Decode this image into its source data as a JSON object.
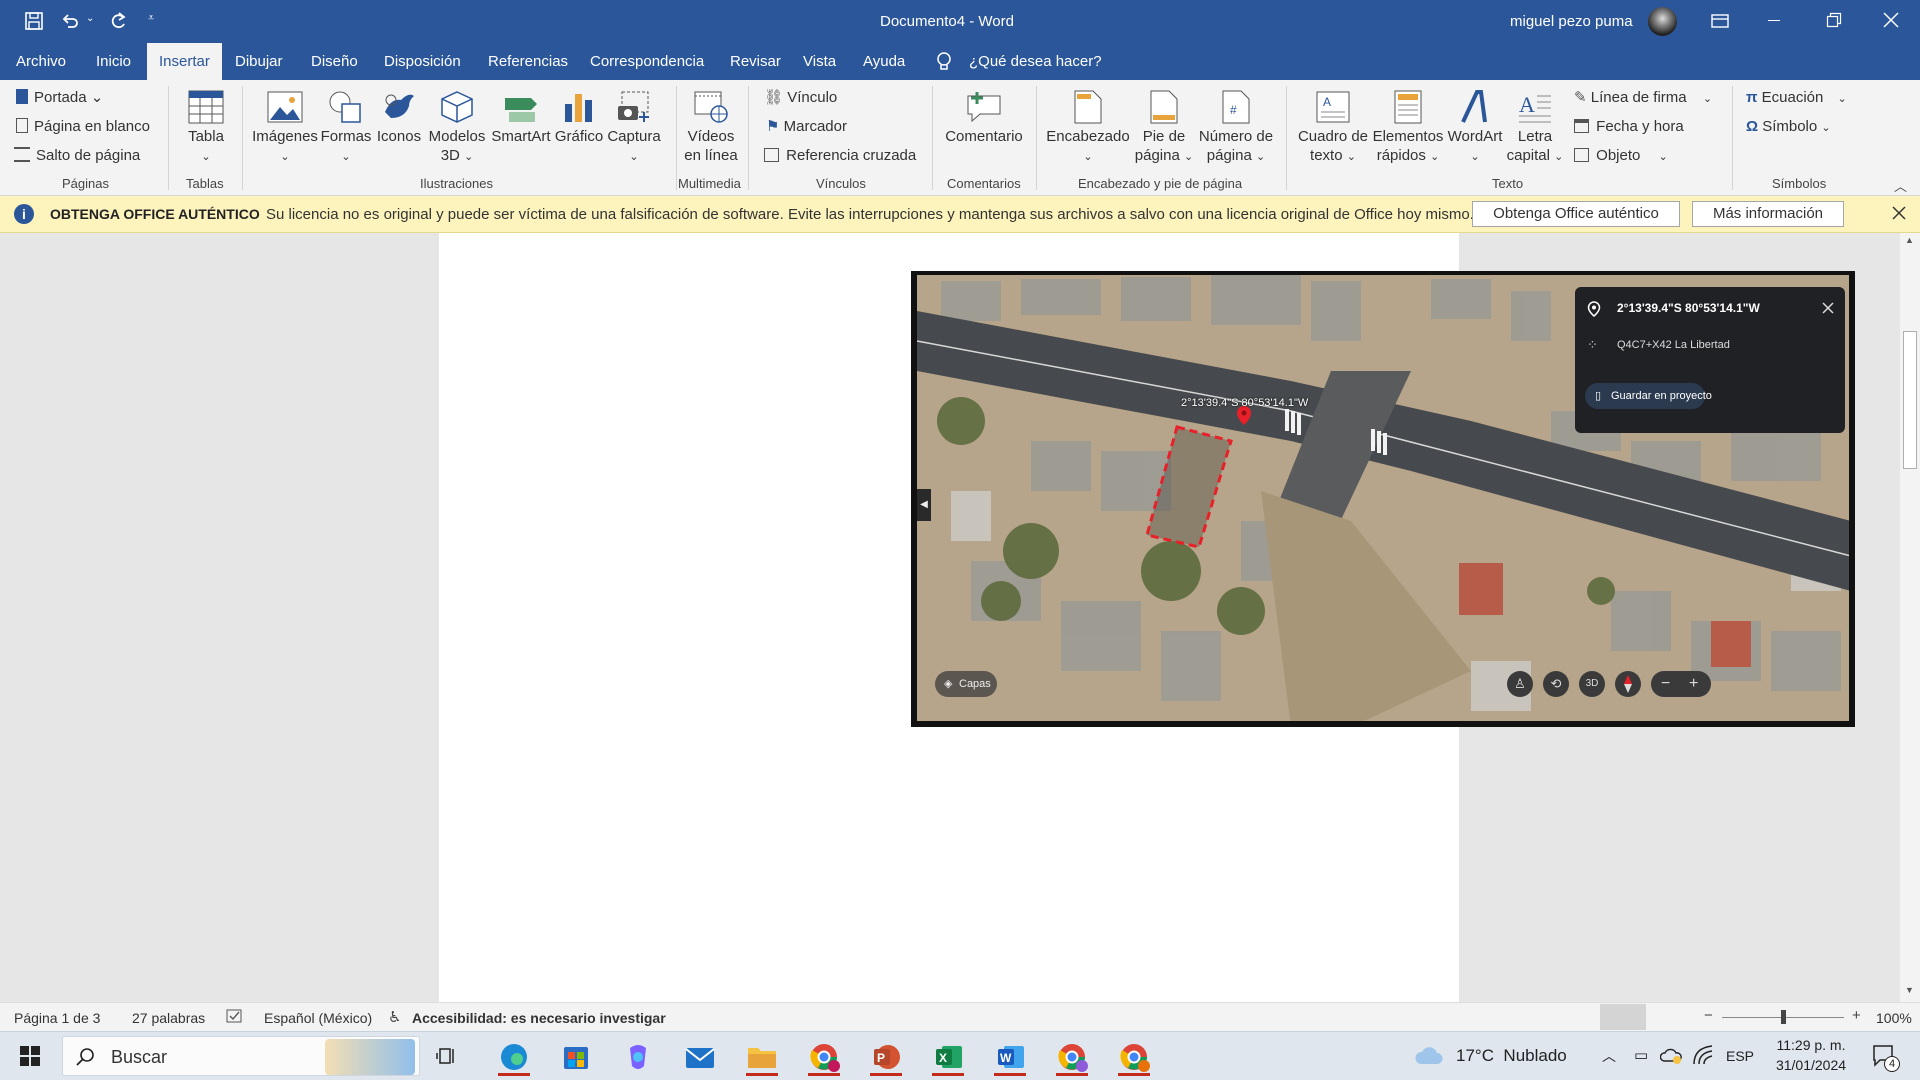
{
  "titlebar": {
    "title": "Documento4  -  Word",
    "user": "miguel pezo puma"
  },
  "tabs": [
    "Archivo",
    "Inicio",
    "Insertar",
    "Dibujar",
    "Diseño",
    "Disposición",
    "Referencias",
    "Correspondencia",
    "Revisar",
    "Vista",
    "Ayuda"
  ],
  "tell_me": "¿Qué desea hacer?",
  "ribbon": {
    "paginas": {
      "portada": "Portada",
      "blank": "Página en blanco",
      "break": "Salto de página",
      "group": "Páginas"
    },
    "tablas": {
      "tabla": "Tabla",
      "group": "Tablas"
    },
    "ilustraciones": {
      "imagenes": "Imágenes",
      "formas": "Formas",
      "iconos": "Iconos",
      "modelos": "Modelos",
      "modelos2": "3D",
      "smartart": "SmartArt",
      "grafico": "Gráfico",
      "captura": "Captura",
      "group": "Ilustraciones"
    },
    "multimedia": {
      "videos": "Vídeos",
      "videos2": "en línea",
      "group": "Multimedia"
    },
    "vinculos": {
      "vinculo": "Vínculo",
      "marcador": "Marcador",
      "ref": "Referencia cruzada",
      "group": "Vínculos"
    },
    "comentarios": {
      "comentario": "Comentario",
      "group": "Comentarios"
    },
    "encabezado": {
      "enc": "Encabezado",
      "pie": "Pie de",
      "pie2": "página",
      "num": "Número de",
      "num2": "página",
      "group": "Encabezado y pie de página"
    },
    "texto": {
      "cuadro": "Cuadro de",
      "cuadro2": "texto",
      "elementos": "Elementos",
      "elementos2": "rápidos",
      "wordart": "WordArt",
      "letra": "Letra",
      "letra2": "capital",
      "firma": "Línea de firma",
      "fecha": "Fecha y hora",
      "objeto": "Objeto",
      "group": "Texto"
    },
    "simbolos": {
      "ecuacion": "Ecuación",
      "simbolo": "Símbolo",
      "group": "Símbolos"
    }
  },
  "license": {
    "title": "OBTENGA OFFICE AUTÉNTICO",
    "message": "Su licencia no es original y puede ser víctima de una falsificación de software. Evite las interrupciones y mantenga sus archivos a salvo con una licencia original de Office hoy mismo.",
    "btn1": "Obtenga Office auténtico",
    "btn2": "Más información"
  },
  "map": {
    "coords": "2°13'39.4\"S 80°53'14.1\"W",
    "pin_label": "2°13'39.4\"S 80°53'14.1\"W",
    "plus_code": "Q4C7+X42 La Libertad",
    "save": "Guardar en proyecto",
    "layers": "Capas",
    "btn3d": "3D"
  },
  "status": {
    "page": "Página 1 de 3",
    "words": "27 palabras",
    "lang": "Español (México)",
    "accessibility": "Accesibilidad: es necesario investigar",
    "zoom": "100%",
    "zoom_fraction": 0.5
  },
  "taskbar": {
    "search": "Buscar",
    "weather": "17°C  Nublado",
    "lang": "ESP",
    "time": "11:29 p. m.",
    "date": "31/01/2024",
    "notifications": "4"
  },
  "colors": {
    "word_blue": "#2b579a",
    "license_bg": "#fdf4bd",
    "plot_outline": "#e8202a"
  }
}
